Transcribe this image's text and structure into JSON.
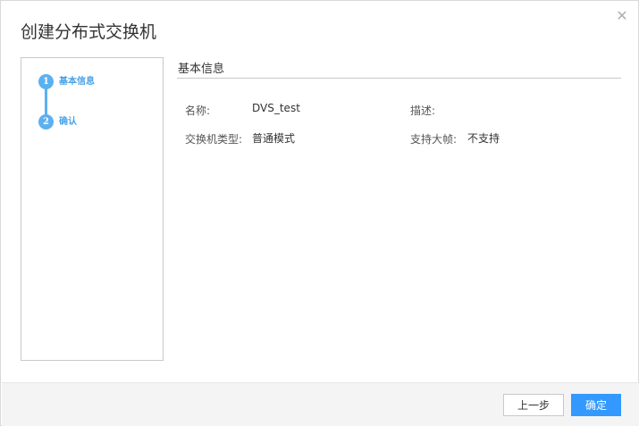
{
  "dialog": {
    "title": "创建分布式交换机",
    "close_glyph": "✕"
  },
  "steps": [
    {
      "number": "1",
      "label": "基本信息",
      "state": "active"
    },
    {
      "number": "2",
      "label": "确认",
      "state": "pending"
    }
  ],
  "section": {
    "title": "基本信息"
  },
  "fields": {
    "name": {
      "label": "名称:",
      "value": "DVS_test"
    },
    "description": {
      "label": "描述:",
      "value": ""
    },
    "switch_type": {
      "label": "交换机类型:",
      "value": "普通模式"
    },
    "jumbo_frame": {
      "label": "支持大帧:",
      "value": "不支持"
    }
  },
  "footer": {
    "prev_label": "上一步",
    "ok_label": "确定"
  },
  "colors": {
    "accent": "#3399ff",
    "step": "#5bb0f0",
    "border": "#c8c8c8",
    "footer_bg": "#f4f4f4"
  }
}
